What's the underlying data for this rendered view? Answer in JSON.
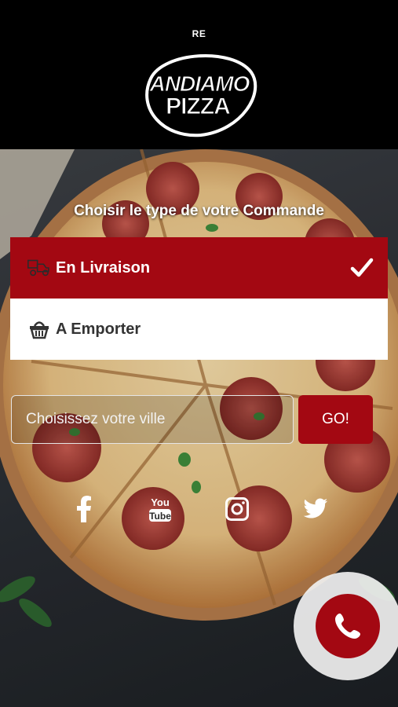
{
  "header": {
    "top_label": "RE",
    "logo_line1": "ANDIAMO",
    "logo_line2": "PIZZA"
  },
  "order_type": {
    "heading": "Choisir le type de votre Commande",
    "options": [
      {
        "label": "En Livraison",
        "icon": "delivery-scooter-icon",
        "selected": true
      },
      {
        "label": "A Emporter",
        "icon": "basket-icon",
        "selected": false
      }
    ]
  },
  "city": {
    "placeholder": "Choisissez votre ville",
    "go_label": "GO!"
  },
  "social": [
    "facebook-icon",
    "youtube-icon",
    "instagram-icon",
    "twitter-icon"
  ],
  "colors": {
    "accent": "#a30812",
    "header_bg": "#000000",
    "option_bg": "#ffffff"
  }
}
